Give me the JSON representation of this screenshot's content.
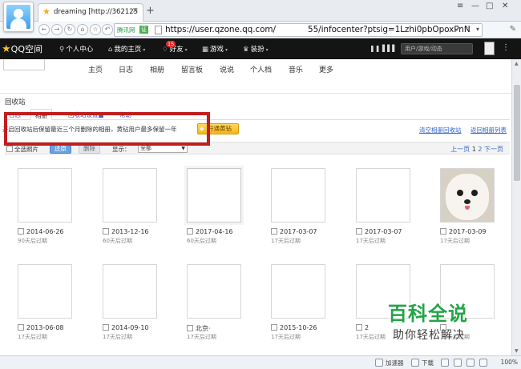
{
  "browser": {
    "tab_title": "dreaming [http://362125",
    "tab_close": "×",
    "new_tab": "+",
    "controls": [
      "≡",
      "—",
      "□",
      "✕"
    ],
    "nav_buttons": [
      "←",
      "→",
      "↻",
      "⌂",
      "☆",
      "↶"
    ],
    "security_label": "腾讯网",
    "security_badge": "证",
    "url_pre": "https://user.qzone.qq.com/",
    "url_post": "55/infocenter?ptsig=1Lzhi0pbOpoxPnN",
    "url_dropdown": "⌄",
    "fav": "☆",
    "url_arrow": "▾",
    "tools": "✎"
  },
  "qzone": {
    "logo": "QQ空间",
    "nav": [
      {
        "icon": "⚲",
        "label": "个人中心",
        "caret": ""
      },
      {
        "icon": "⌂",
        "label": "我的主页",
        "caret": "▾"
      },
      {
        "icon": "♢",
        "label": "好友",
        "caret": "▾"
      },
      {
        "icon": "▦",
        "label": "游戏",
        "caret": "▾"
      },
      {
        "icon": "♛",
        "label": "装扮",
        "caret": "▾"
      }
    ],
    "notif_count": "15",
    "right_icons": "❚❚ ▌▌▌",
    "search_placeholder": "用户/游戏/动态",
    "more": "⋮"
  },
  "subnav": [
    "主页",
    "日志",
    "相册",
    "留言板",
    "说说",
    "个人档",
    "音乐",
    "更多"
  ],
  "recycle": {
    "title": "回收站",
    "tabs": [
      "日志",
      "相册",
      "回收站设置■",
      "帮助"
    ],
    "notice": "开启回收站后保留最近三个月删除的相册，黄钻用户最多保留一年",
    "open_button": "开通黄钻",
    "open_icon": "◆",
    "link_clear": "清空相册回收站",
    "link_back": "返回相册列表"
  },
  "toolbar": {
    "select_all": "全选照片",
    "restore": "还原",
    "delete": "删除",
    "show_label": "显示：",
    "show_value": "全部",
    "prev": "上一页",
    "page1": "1",
    "page2": "2",
    "next": "下一页"
  },
  "photos": [
    {
      "date": "2014-06-26",
      "expire": "90天后过期"
    },
    {
      "date": "2013-12-16",
      "expire": "60天后过期"
    },
    {
      "date": "2017-04-16",
      "expire": "60天后过期"
    },
    {
      "date": "2017-03-07",
      "expire": "17天后过期"
    },
    {
      "date": "2017-03-07",
      "expire": "17天后过期"
    },
    {
      "date": "2017-03-09",
      "expire": "17天后过期"
    },
    {
      "date": "2013-06-08",
      "expire": "17天后过期"
    },
    {
      "date": "2014-09-10",
      "expire": "17天后过期"
    },
    {
      "date": "北京·",
      "expire": "17天后过期"
    },
    {
      "date": "2015-10-26",
      "expire": "17天后过期"
    },
    {
      "date": "2",
      "expire": "17天后过期"
    },
    {
      "date": "",
      "expire": "17天后过期"
    }
  ],
  "watermark": {
    "big": "百科全说",
    "small": "助你轻松解决"
  },
  "statusbar": {
    "accelerator": "加速器",
    "download": "下载",
    "zoom": "100%"
  },
  "colors": {
    "qzone_bar": "#141414",
    "highlight_box": "#c11e1e",
    "link": "#3366cc",
    "vip_button": "#f5b417",
    "watermark": "#22a447"
  }
}
